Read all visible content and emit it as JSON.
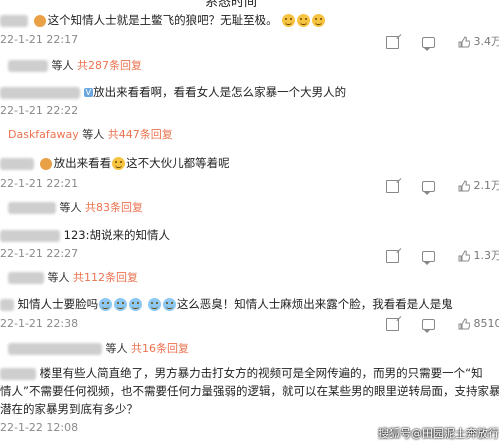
{
  "header": {
    "title": "系态时间"
  },
  "comments": [
    {
      "text": "这个知情人士就是土鳖飞的狼吧？无耻至极。",
      "timestamp": "22-1-21 22:17",
      "likes": "3.4万"
    },
    {
      "user_suffix": "等人",
      "replies": "共287条回复"
    },
    {
      "text": "放出来看看啊，看看女人是怎么家暴一个大男人的",
      "timestamp": "22-1-21 22:22"
    },
    {
      "username": "Daskfafaway",
      "user_suffix": "等人",
      "replies": "共447条回复"
    },
    {
      "text": "放出来看看",
      "text2": "这不大伙儿都等着呢",
      "timestamp": "22-1-21 22:21",
      "likes": "2.1万"
    },
    {
      "user_suffix": "等人",
      "replies": "共83条回复"
    },
    {
      "text": "123:胡说来的知情人",
      "timestamp": "22-1-21 22:27",
      "likes": "1.3万"
    },
    {
      "user_suffix": "等人",
      "replies": "共112条回复"
    },
    {
      "text": "知情人士要脸吗",
      "text2": "这么恶臭！知情人士麻烦出来露个脸，我看看是人是鬼",
      "timestamp": "22-1-21 22:38",
      "likes": "8510"
    },
    {
      "user_suffix": "等人",
      "replies": "共16条回复"
    },
    {
      "text": "楼里有些人简直绝了，男方暴力击打女方的视频可是全网传遍的，而男的只需要一个“知",
      "line2": "情人”不需要任何视频，也不需要任何力量强弱的逻辑，就可以在某些男的眼里逆转局面，支持家暴男，",
      "line3": "潜在的家暴男到底有多少？",
      "timestamp": "22-1-22 12:08"
    }
  ],
  "watermark": "搜狐号@田园泥土奔放行"
}
